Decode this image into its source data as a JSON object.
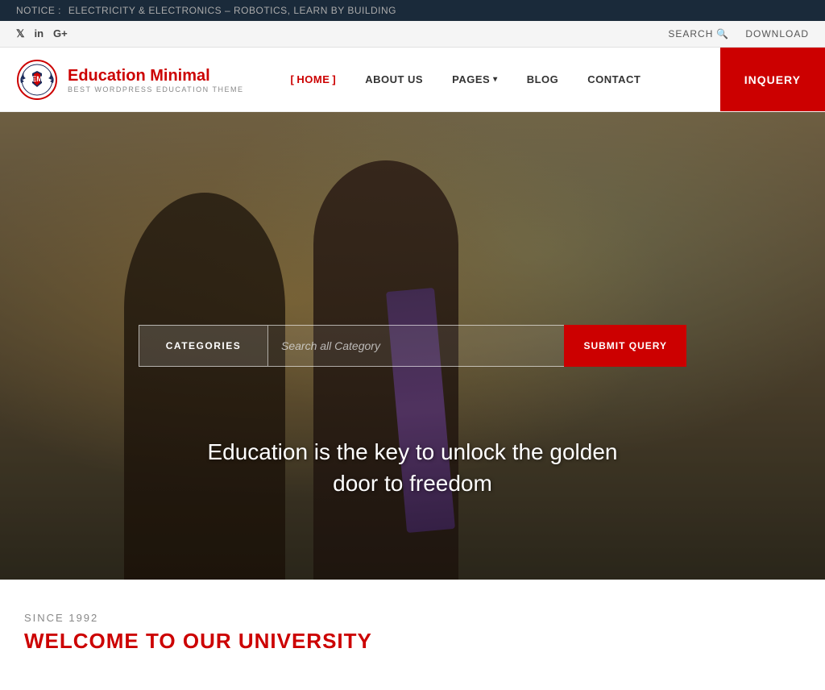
{
  "notice": {
    "prefix": "NOTICE :",
    "text": "ELECTRICITY & ELECTRONICS – ROBOTICS, LEARN BY BUILDING"
  },
  "social": {
    "icons": [
      "𝕏",
      "in",
      "G+"
    ],
    "search_label": "SEARCH",
    "download_label": "DOWNLOAD"
  },
  "header": {
    "logo": {
      "initials": "EM",
      "name_part1": "Education ",
      "name_part2": "Minimal",
      "tagline": "BEST WORDPRESS EDUCATION THEME"
    },
    "nav": [
      {
        "label": "HOME",
        "active": true
      },
      {
        "label": "ABOUT US",
        "active": false
      },
      {
        "label": "PAGES",
        "active": false,
        "has_dropdown": true
      },
      {
        "label": "BLOG",
        "active": false
      },
      {
        "label": "CONTACT",
        "active": false
      }
    ],
    "inquiry_label": "INQUERY"
  },
  "hero": {
    "search": {
      "categories_label": "CATEGORIES",
      "placeholder": "Search all Category",
      "submit_label": "SUBMIT QUERY"
    },
    "tagline": "Education is the key to unlock the golden door to freedom"
  },
  "since_section": {
    "since_label": "SINCE 1992",
    "welcome_title": "WELCOME TO OUR UNIVERSITY"
  }
}
